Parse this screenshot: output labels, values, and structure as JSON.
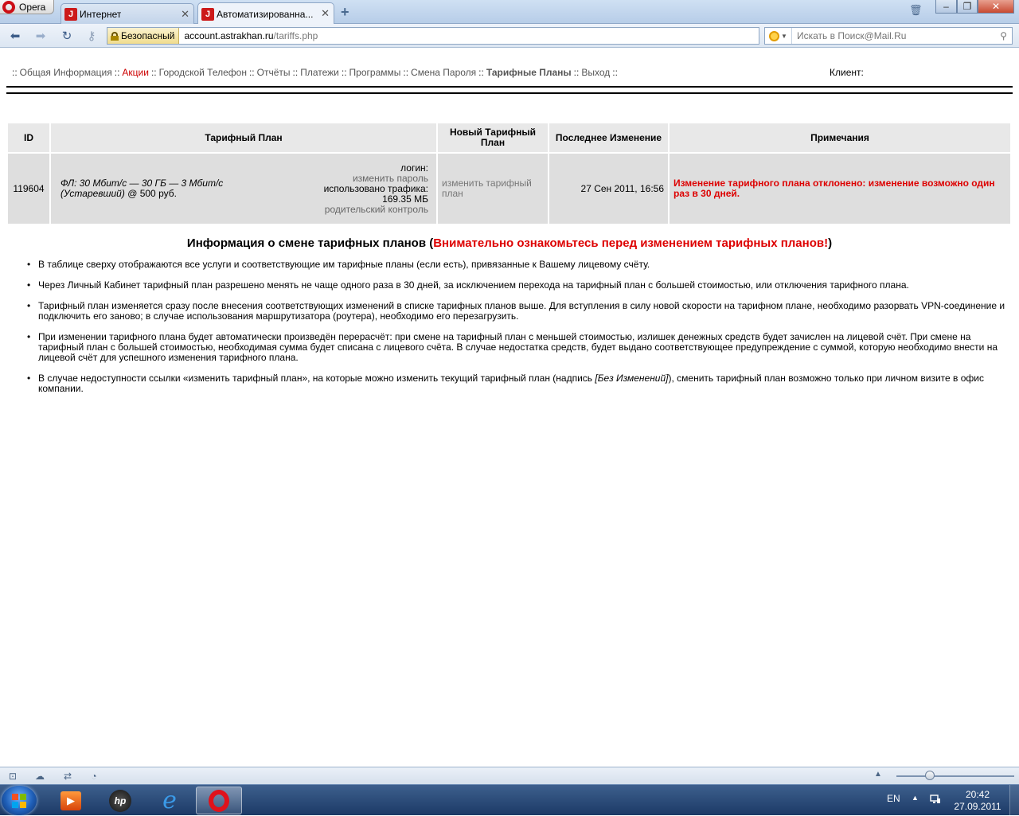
{
  "browser": {
    "menu_label": "Opera",
    "tabs": [
      {
        "title": "Интернет"
      },
      {
        "title": "Автоматизированна..."
      }
    ],
    "address": {
      "security_label": "Безопасный",
      "url_host": "account.astrakhan.ru",
      "url_path": "/tariffs.php"
    },
    "search": {
      "placeholder": "Искать в Поиск@Mail.Ru"
    }
  },
  "page": {
    "menu": [
      {
        "label": "Общая Информация",
        "style": "normal"
      },
      {
        "label": "Акции",
        "style": "red"
      },
      {
        "label": "Городской Телефон",
        "style": "normal"
      },
      {
        "label": "Отчёты",
        "style": "normal"
      },
      {
        "label": "Платежи",
        "style": "normal"
      },
      {
        "label": "Программы",
        "style": "normal"
      },
      {
        "label": "Смена Пароля",
        "style": "normal"
      },
      {
        "label": "Тарифные Планы",
        "style": "bold"
      },
      {
        "label": "Выход",
        "style": "normal"
      }
    ],
    "menu_separator": "::",
    "client_label": "Клиент:",
    "table": {
      "headers": {
        "id": "ID",
        "plan": "Тарифный План",
        "new_plan": "Новый Тарифный План",
        "last_change": "Последнее Изменение",
        "notes": "Примечания"
      },
      "row": {
        "id": "119604",
        "plan_name": "ФЛ: 30 Мбит/с — 30 ГБ — 3 Мбит/с (Устаревший)",
        "plan_price": " @ 500 руб.",
        "login_label": "логин:",
        "change_password": "изменить пароль",
        "traffic_label": "использовано трафика:",
        "traffic_value": "169.35 МБ",
        "parental_control": "родительский контроль",
        "new_plan_link": "изменить тарифный план",
        "last_change": "27 Сен 2011, 16:56",
        "note": "Изменение тарифного плана отклонено: изменение возможно один раз в 30 дней."
      }
    },
    "info": {
      "title_main": "Информация о смене тарифных планов (",
      "title_warn": "Внимательно ознакомьтесь перед изменением тарифных планов!",
      "title_end": ")",
      "items": [
        "В таблице сверху отображаются все услуги и соответствующие им тарифные планы (если есть), привязанные к Вашему лицевому счёту.",
        "Через Личный Кабинет тарифный план разрешено менять не чаще одного раза в 30 дней, за исключением перехода на тарифный план с большей стоимостью, или отключения тарифного плана.",
        "Тарифный план изменяется сразу после внесения соответствующих изменений в списке тарифных планов выше. Для вступления в силу новой скорости на тарифном плане, необходимо разорвать VPN-соединение и подключить его заново; в случае использования маршрутизатора (роутера), необходимо его перезагрузить.",
        "При изменении тарифного плана будет автоматически произведён перерасчёт: при смене на тарифный план с меньшей стоимостью, излишек денежных средств будет зачислен на лицевой счёт. При смене на тарифный план с большей стоимостью, необходимая сумма будет списана с лицевого счёта. В случае недостатка средств, будет выдано соответствующее предупреждение с суммой, которую необходимо внести на лицевой счёт для успешного изменения тарифного плана."
      ],
      "last_item_before": "В случае недоступности ссылки «изменить тарифный план», на которые можно изменить текущий тарифный план (надпись ",
      "last_item_em": "[Без Изменений]",
      "last_item_after": "), сменить тарифный план возможно только при личном визите в офис компании."
    }
  },
  "taskbar": {
    "language": "EN",
    "time": "20:42",
    "date": "27.09.2011"
  },
  "colors": {
    "accent_red": "#dd0000",
    "menu_gray": "#555555",
    "table_header_bg": "#e8e8e8",
    "table_cell_bg": "#dedede"
  }
}
